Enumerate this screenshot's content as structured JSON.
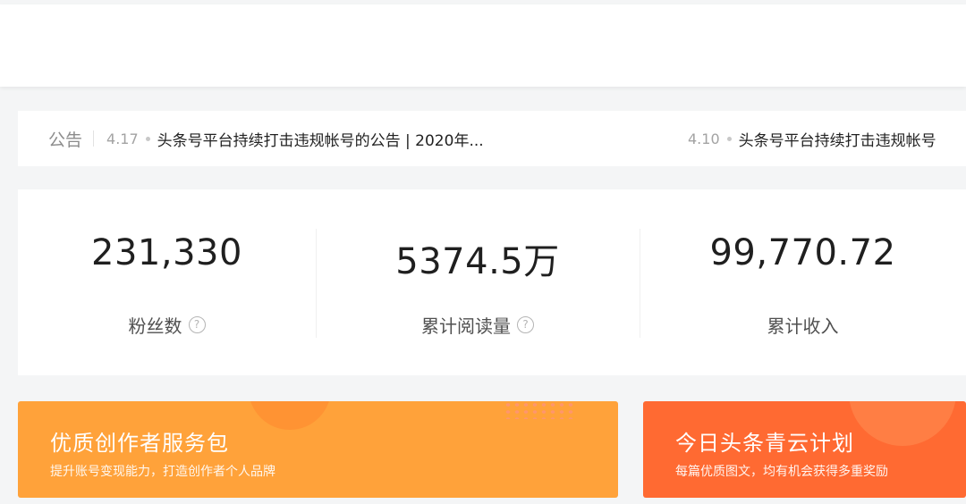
{
  "notice": {
    "label": "公告",
    "items": [
      {
        "date": "4.17",
        "text": "头条号平台持续打击违规帐号的公告 | 2020年..."
      },
      {
        "date": "4.10",
        "text": "头条号平台持续打击违规帐号"
      }
    ]
  },
  "stats": [
    {
      "value": "231,330",
      "label": "粉丝数",
      "help_icon": "question-circle-icon"
    },
    {
      "value": "5374.5万",
      "label": "累计阅读量",
      "help_icon": "question-circle-icon"
    },
    {
      "value": "99,770.72",
      "label": "累计收入"
    }
  ],
  "cards": [
    {
      "title": "优质创作者服务包",
      "subtitle": "提升账号变现能力，打造创作者个人品牌",
      "color": "#ffa23a"
    },
    {
      "title": "今日头条青云计划",
      "subtitle": "每篇优质图文，均有机会获得多重奖励",
      "color": "#ff6a32"
    }
  ],
  "help_glyph": "?"
}
